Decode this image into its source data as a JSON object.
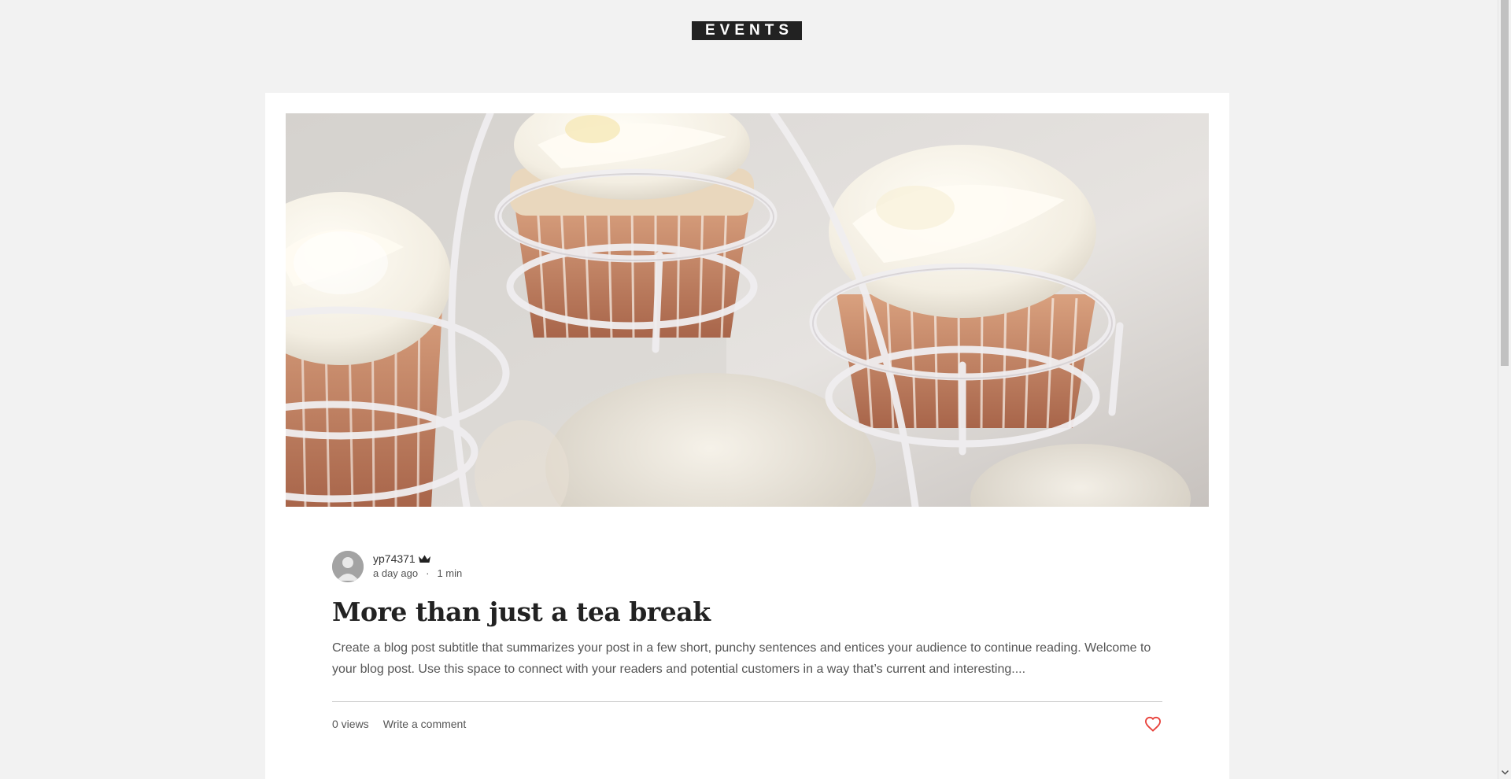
{
  "header": {
    "logo_text": "EVENTS"
  },
  "post": {
    "hero_image_alt": "cupcakes-on-stand-image",
    "author": {
      "name": "yp74371",
      "badge_icon": "crown-icon",
      "avatar_icon": "user-avatar-icon"
    },
    "meta": {
      "posted": "a day ago",
      "separator": "·",
      "read_time": "1 min"
    },
    "title": "More than just a tea break",
    "excerpt": "Create a blog post subtitle that summarizes your post in a few short, punchy sentences and entices your audience to continue reading. Welcome to your blog post. Use this space to connect with your readers and potential customers in a way that’s current and interesting....",
    "footer": {
      "views": "0 views",
      "comment_label": "Write a comment",
      "like_icon": "heart-icon"
    }
  },
  "colors": {
    "page_background": "#f2f2f2",
    "card_background": "#ffffff",
    "logo_background": "#222222",
    "like_accent": "#e8413b",
    "text_dark": "#222222",
    "text_muted": "#555555"
  }
}
